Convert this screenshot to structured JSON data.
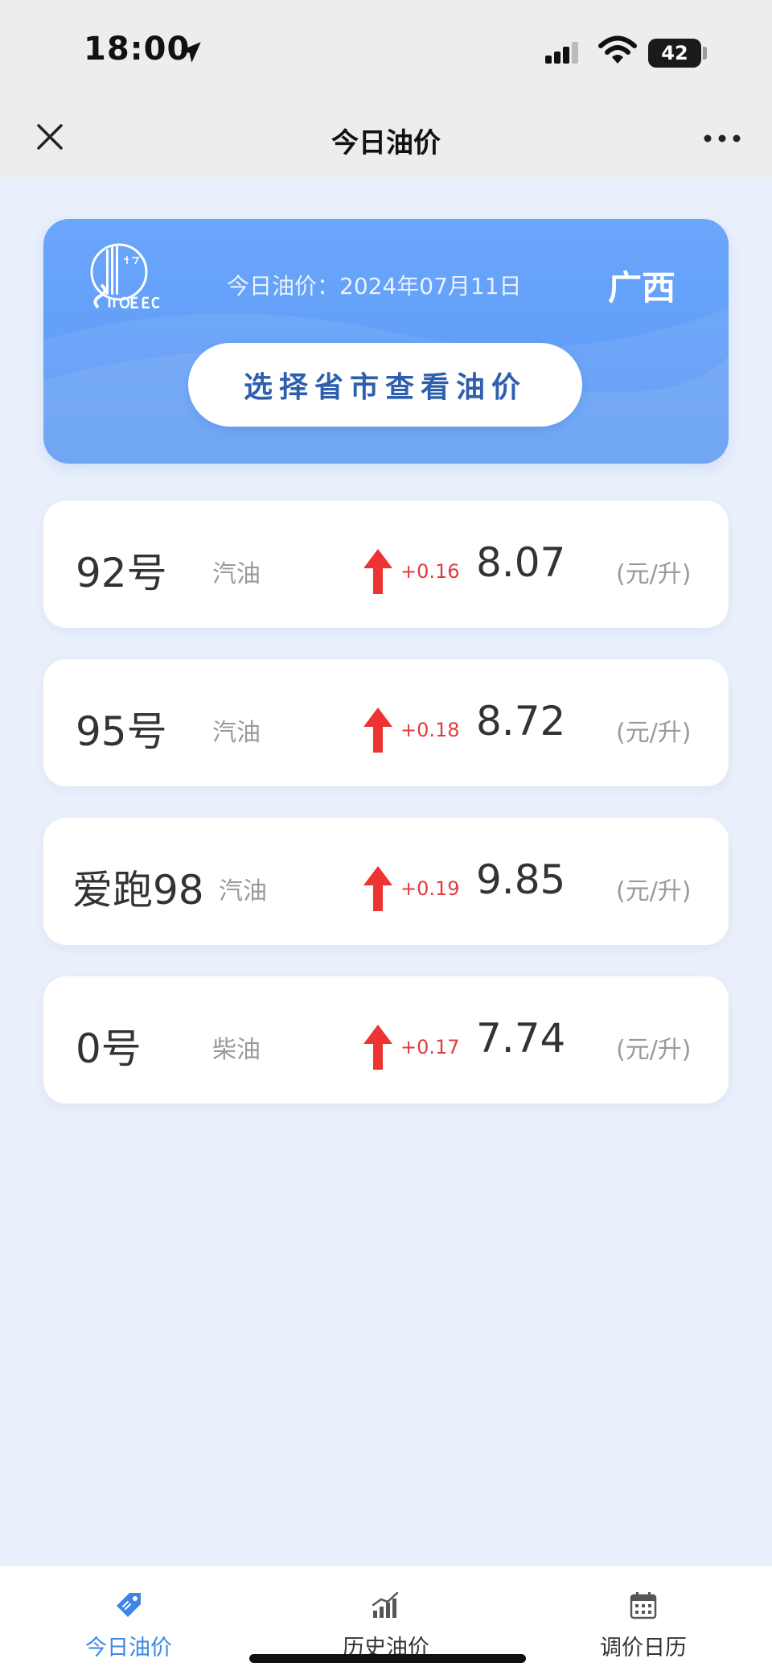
{
  "status_bar": {
    "time": "18:00",
    "battery": "42"
  },
  "nav": {
    "title": "今日油价"
  },
  "banner": {
    "date_text": "今日油价：2024年07月11日",
    "province": "广西",
    "select_button": "选择省市查看油价"
  },
  "prices": [
    {
      "name": "92号",
      "type": "汽油",
      "change": "+0.16",
      "price": "8.07",
      "unit": "(元/升)"
    },
    {
      "name": "95号",
      "type": "汽油",
      "change": "+0.18",
      "price": "8.72",
      "unit": "(元/升)"
    },
    {
      "name": "爱跑98",
      "type": "汽油",
      "change": "+0.19",
      "price": "9.85",
      "unit": "(元/升)"
    },
    {
      "name": "0号",
      "type": "柴油",
      "change": "+0.17",
      "price": "7.74",
      "unit": "(元/升)"
    }
  ],
  "tabs": [
    {
      "label": "今日油价",
      "icon": "tag-icon",
      "active": true
    },
    {
      "label": "历史油价",
      "icon": "bar-chart-icon",
      "active": false
    },
    {
      "label": "调价日历",
      "icon": "calendar-icon",
      "active": false
    }
  ],
  "colors": {
    "accent": "#3d86e8",
    "banner": "#5b98f4",
    "increase": "#e23b3b"
  }
}
